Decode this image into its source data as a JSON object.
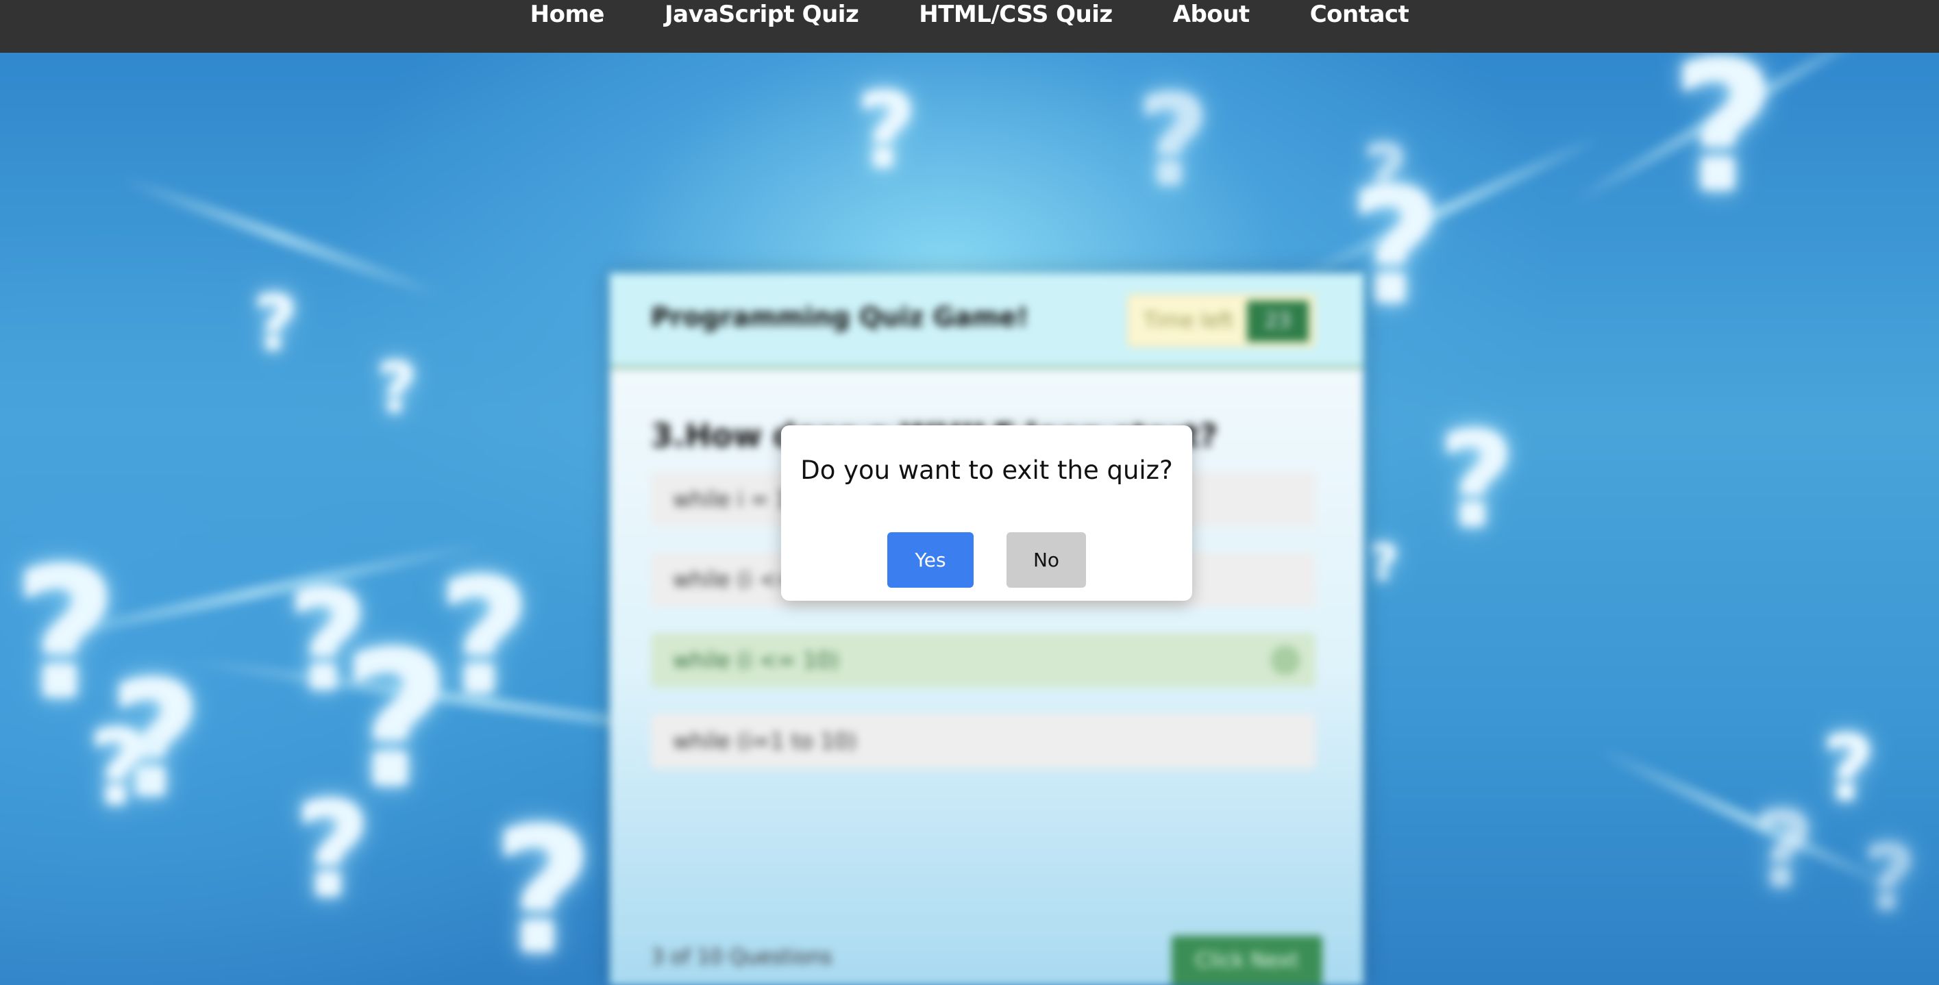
{
  "nav": {
    "items": [
      {
        "label": "Home"
      },
      {
        "label": "JavaScript Quiz"
      },
      {
        "label": "HTML/CSS Quiz"
      },
      {
        "label": "About"
      },
      {
        "label": "Contact"
      }
    ]
  },
  "quiz": {
    "title": "Programming Quiz Game!",
    "timer_label": "Time left",
    "timer_value": "23",
    "question": "3.How does a WHILE loop start?",
    "options": [
      {
        "label": "while i = 1 to 10",
        "state": "default"
      },
      {
        "label": "while (i <= 10; i++)",
        "state": "default"
      },
      {
        "label": "while (i <= 10)",
        "state": "correct"
      },
      {
        "label": "while (i=1 to 10)",
        "state": "default"
      }
    ],
    "footer_count": "3 of 10 Questions",
    "next_label": "Click Next"
  },
  "modal": {
    "message": "Do you want to exit the quiz?",
    "yes_label": "Yes",
    "no_label": "No"
  },
  "colors": {
    "navbar": "#333333",
    "yes_button": "#3b7ef0",
    "no_button": "#cccccc",
    "correct_option": "#d5e9d0"
  }
}
